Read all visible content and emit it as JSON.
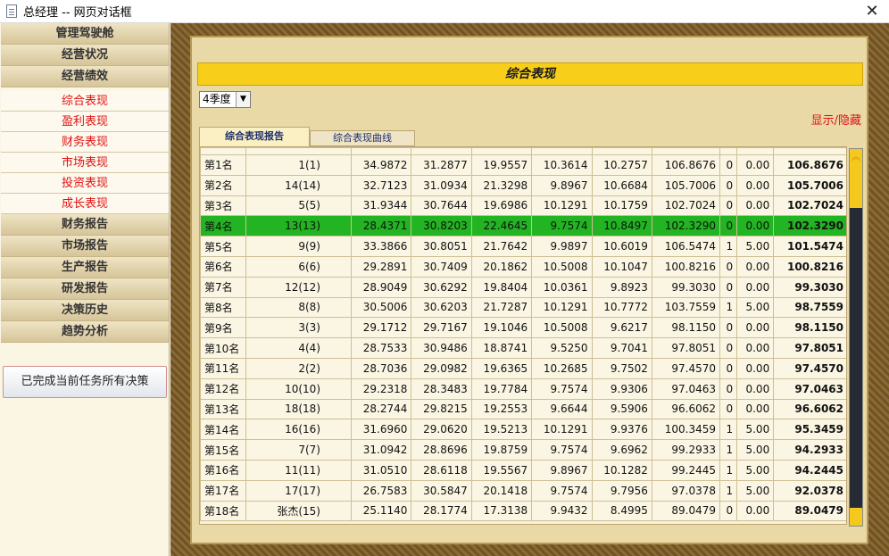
{
  "window": {
    "title": "总经理 -- 网页对话框",
    "close": "✕"
  },
  "sidebar": {
    "groups_top": [
      "管理驾驶舱",
      "经营状况",
      "经营绩效"
    ],
    "sub_items": [
      "综合表现",
      "盈利表现",
      "财务表现",
      "市场表现",
      "投资表现",
      "成长表现"
    ],
    "groups_bottom": [
      "财务报告",
      "市场报告",
      "生产报告",
      "研发报告",
      "决策历史",
      "趋势分析"
    ],
    "done_button": "已完成当前任务所有决策"
  },
  "main": {
    "header": "综合表现",
    "quarter": {
      "selected": "4季度",
      "arrow": "▼"
    },
    "toggle": "显示/隐藏",
    "tabs": [
      "综合表现报告",
      "综合表现曲线"
    ],
    "scroll_up": "︽",
    "highlight_row": 3,
    "rows": [
      [
        "第1名",
        "1(1)",
        "34.9872",
        "31.2877",
        "19.9557",
        "10.3614",
        "10.2757",
        "106.8676",
        "0",
        "0.00",
        "106.8676"
      ],
      [
        "第2名",
        "14(14)",
        "32.7123",
        "31.0934",
        "21.3298",
        "9.8967",
        "10.6684",
        "105.7006",
        "0",
        "0.00",
        "105.7006"
      ],
      [
        "第3名",
        "5(5)",
        "31.9344",
        "30.7644",
        "19.6986",
        "10.1291",
        "10.1759",
        "102.7024",
        "0",
        "0.00",
        "102.7024"
      ],
      [
        "第4名",
        "13(13)",
        "28.4371",
        "30.8203",
        "22.4645",
        "9.7574",
        "10.8497",
        "102.3290",
        "0",
        "0.00",
        "102.3290"
      ],
      [
        "第5名",
        "9(9)",
        "33.3866",
        "30.8051",
        "21.7642",
        "9.9897",
        "10.6019",
        "106.5474",
        "1",
        "5.00",
        "101.5474"
      ],
      [
        "第6名",
        "6(6)",
        "29.2891",
        "30.7409",
        "20.1862",
        "10.5008",
        "10.1047",
        "100.8216",
        "0",
        "0.00",
        "100.8216"
      ],
      [
        "第7名",
        "12(12)",
        "28.9049",
        "30.6292",
        "19.8404",
        "10.0361",
        "9.8923",
        "99.3030",
        "0",
        "0.00",
        "99.3030"
      ],
      [
        "第8名",
        "8(8)",
        "30.5006",
        "30.6203",
        "21.7287",
        "10.1291",
        "10.7772",
        "103.7559",
        "1",
        "5.00",
        "98.7559"
      ],
      [
        "第9名",
        "3(3)",
        "29.1712",
        "29.7167",
        "19.1046",
        "10.5008",
        "9.6217",
        "98.1150",
        "0",
        "0.00",
        "98.1150"
      ],
      [
        "第10名",
        "4(4)",
        "28.7533",
        "30.9486",
        "18.8741",
        "9.5250",
        "9.7041",
        "97.8051",
        "0",
        "0.00",
        "97.8051"
      ],
      [
        "第11名",
        "2(2)",
        "28.7036",
        "29.0982",
        "19.6365",
        "10.2685",
        "9.7502",
        "97.4570",
        "0",
        "0.00",
        "97.4570"
      ],
      [
        "第12名",
        "10(10)",
        "29.2318",
        "28.3483",
        "19.7784",
        "9.7574",
        "9.9306",
        "97.0463",
        "0",
        "0.00",
        "97.0463"
      ],
      [
        "第13名",
        "18(18)",
        "28.2744",
        "29.8215",
        "19.2553",
        "9.6644",
        "9.5906",
        "96.6062",
        "0",
        "0.00",
        "96.6062"
      ],
      [
        "第14名",
        "16(16)",
        "31.6960",
        "29.0620",
        "19.5213",
        "10.1291",
        "9.9376",
        "100.3459",
        "1",
        "5.00",
        "95.3459"
      ],
      [
        "第15名",
        "7(7)",
        "31.0942",
        "28.8696",
        "19.8759",
        "9.7574",
        "9.6962",
        "99.2933",
        "1",
        "5.00",
        "94.2933"
      ],
      [
        "第16名",
        "11(11)",
        "31.0510",
        "28.6118",
        "19.5567",
        "9.8967",
        "10.1282",
        "99.2445",
        "1",
        "5.00",
        "94.2445"
      ],
      [
        "第17名",
        "17(17)",
        "26.7583",
        "30.5847",
        "20.1418",
        "9.7574",
        "9.7956",
        "97.0378",
        "1",
        "5.00",
        "92.0378"
      ],
      [
        "第18名",
        "张杰(15)",
        "25.1140",
        "28.1774",
        "17.3138",
        "9.9432",
        "8.4995",
        "89.0479",
        "0",
        "0.00",
        "89.0479"
      ]
    ]
  }
}
